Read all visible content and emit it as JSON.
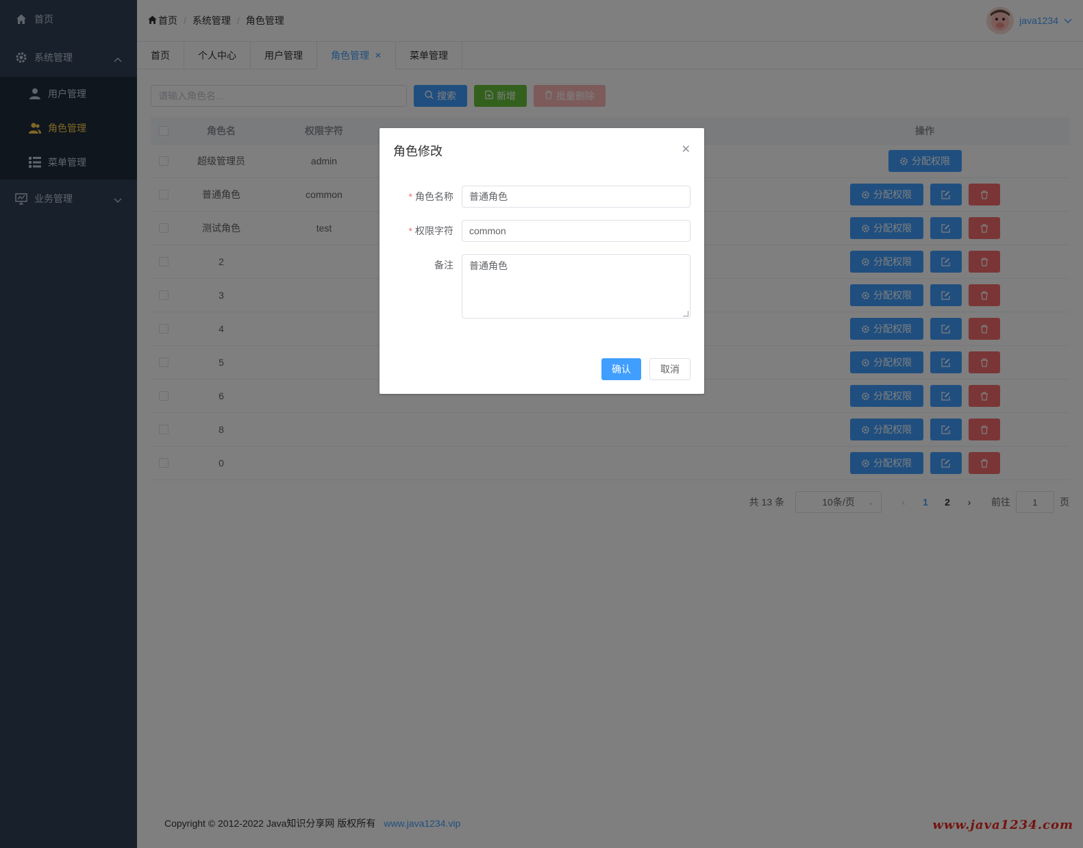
{
  "sidebar": {
    "home": "首页",
    "system": "系统管理",
    "system_items": [
      "用户管理",
      "角色管理",
      "菜单管理"
    ],
    "business": "业务管理"
  },
  "header": {
    "breadcrumb": [
      "首页",
      "系统管理",
      "角色管理"
    ],
    "username": "java1234"
  },
  "tabs": [
    "首页",
    "个人中心",
    "用户管理",
    "角色管理",
    "菜单管理"
  ],
  "toolbar": {
    "search_placeholder": "请输入角色名...",
    "search_label": "搜索",
    "add_label": "新增",
    "batch_delete_label": "批量删除"
  },
  "table": {
    "headers": {
      "name": "角色名",
      "key": "权限字符",
      "op": "操作"
    },
    "rows": [
      {
        "name": "超级管理员",
        "key": "admin"
      },
      {
        "name": "普通角色",
        "key": "common"
      },
      {
        "name": "测试角色",
        "key": "test"
      },
      {
        "name": "2",
        "key": ""
      },
      {
        "name": "3",
        "key": ""
      },
      {
        "name": "4",
        "key": ""
      },
      {
        "name": "5",
        "key": ""
      },
      {
        "name": "6",
        "key": ""
      },
      {
        "name": "8",
        "key": ""
      },
      {
        "name": "0",
        "key": ""
      }
    ],
    "perm_label": "分配权限"
  },
  "pagination": {
    "total": "共 13 条",
    "page_size": "10条/页",
    "pages": [
      "1",
      "2"
    ],
    "current": "1",
    "goto_label": "前往",
    "goto_value": "1",
    "page_unit": "页"
  },
  "footer": {
    "copyright": "Copyright © 2012-2022 Java知识分享网 版权所有",
    "link": "www.java1234.vip"
  },
  "watermark": "www.java1234.com",
  "dialog": {
    "title": "角色修改",
    "name_label": "角色名称",
    "name_value": "普通角色",
    "key_label": "权限字符",
    "key_value": "common",
    "remark_label": "备注",
    "remark_value": "普通角色",
    "ok_label": "确认",
    "cancel_label": "取消"
  },
  "colors": {
    "primary": "#409eff",
    "success": "#67c23a",
    "danger": "#f56c6c",
    "sidebar_bg": "#304156",
    "sidebar_active": "#ffd04b"
  }
}
